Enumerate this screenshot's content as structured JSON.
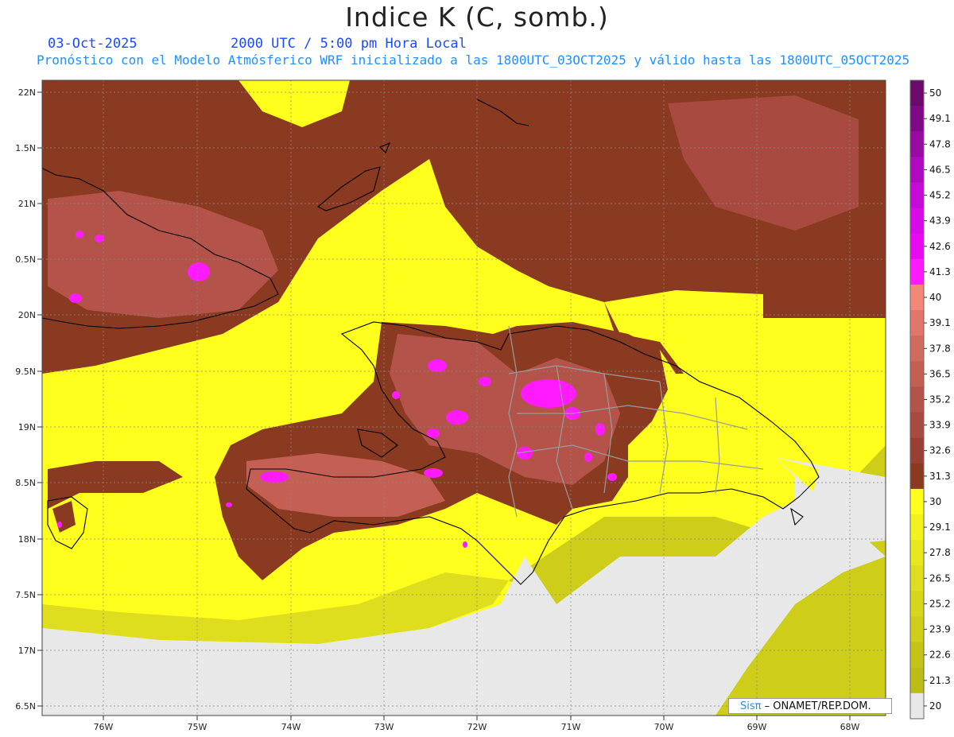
{
  "header": {
    "title": "Indice K (C, somb.)",
    "date": "03-Oct-2025",
    "time": "2000 UTC / 5:00 pm Hora Local",
    "description": "Pronóstico con el Modelo Atmósferico WRF inicializado a las 1800UTC_03OCT2025 y válido hasta las  1800UTC_05OCT2025"
  },
  "map": {
    "lat_labels": [
      "22N",
      "1.5N",
      "21N",
      "0.5N",
      "20N",
      "9.5N",
      "19N",
      "8.5N",
      "18N",
      "7.5N",
      "17N",
      "6.5N"
    ],
    "lon_labels": [
      "76W",
      "75W",
      "74W",
      "73W",
      "72W",
      "71W",
      "70W",
      "69W",
      "68W"
    ],
    "colors": {
      "ocean_nodata": "#e8e8e8",
      "coast": "#000000",
      "border": "#999999"
    }
  },
  "colorbar": {
    "labels": [
      "50",
      "49.1",
      "47.8",
      "46.5",
      "45.2",
      "43.9",
      "42.6",
      "41.3",
      "40",
      "39.1",
      "37.8",
      "36.5",
      "35.2",
      "33.9",
      "32.6",
      "31.3",
      "30",
      "29.1",
      "27.8",
      "26.5",
      "25.2",
      "23.9",
      "22.6",
      "21.3",
      "20"
    ],
    "colors": [
      "#6b0a6b",
      "#800a86",
      "#990aa3",
      "#b00ac0",
      "#c60ad8",
      "#d90ae8",
      "#ea0af2",
      "#ff1aff",
      "#f48878",
      "#e2766a",
      "#d16a5e",
      "#c35f53",
      "#b3534a",
      "#a84a40",
      "#9a3f33",
      "#8b3a22",
      "#ffff1e",
      "#f2f21e",
      "#e8e81e",
      "#dede1e",
      "#d6d61a",
      "#cece1a",
      "#c4c418",
      "#bcbc16",
      "#e8e8e8"
    ]
  },
  "credit": {
    "logo": "Sisπ",
    "text": "– ONAMET/REP.DOM."
  }
}
